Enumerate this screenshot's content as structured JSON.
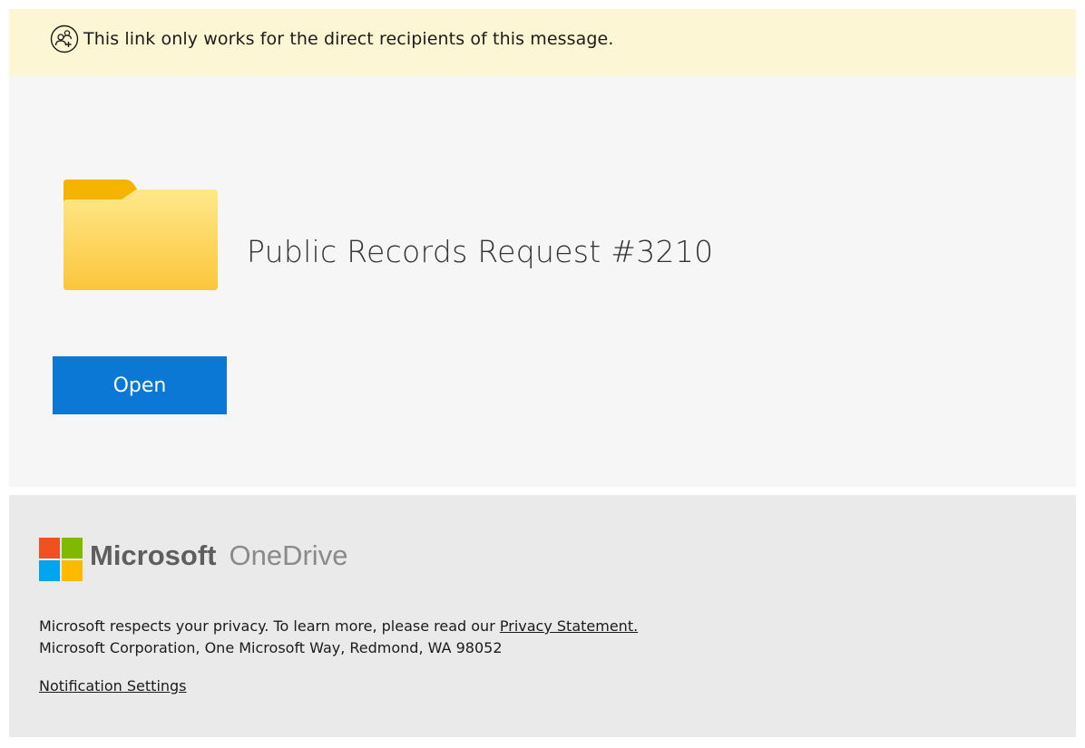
{
  "banner": {
    "icon": "people-add-icon",
    "text": "This link only works for the direct recipients of this message."
  },
  "item": {
    "icon": "folder-icon",
    "title": "Public Records Request #3210",
    "folder_color": "#fcc840"
  },
  "open_button": {
    "label": "Open",
    "color": "#0a78d4"
  },
  "footer": {
    "logo": "microsoft-logo",
    "brand_primary": "Microsoft",
    "brand_product": "OneDrive",
    "logo_colors": [
      "#f25022",
      "#7fba00",
      "#00a4ef",
      "#ffb900"
    ],
    "privacy_text": "Microsoft respects your privacy. To learn more, please read our",
    "privacy_link": "Privacy Statement.",
    "address": "Microsoft Corporation, One Microsoft Way, Redmond, WA 98052",
    "notification_link": "Notification Settings"
  }
}
